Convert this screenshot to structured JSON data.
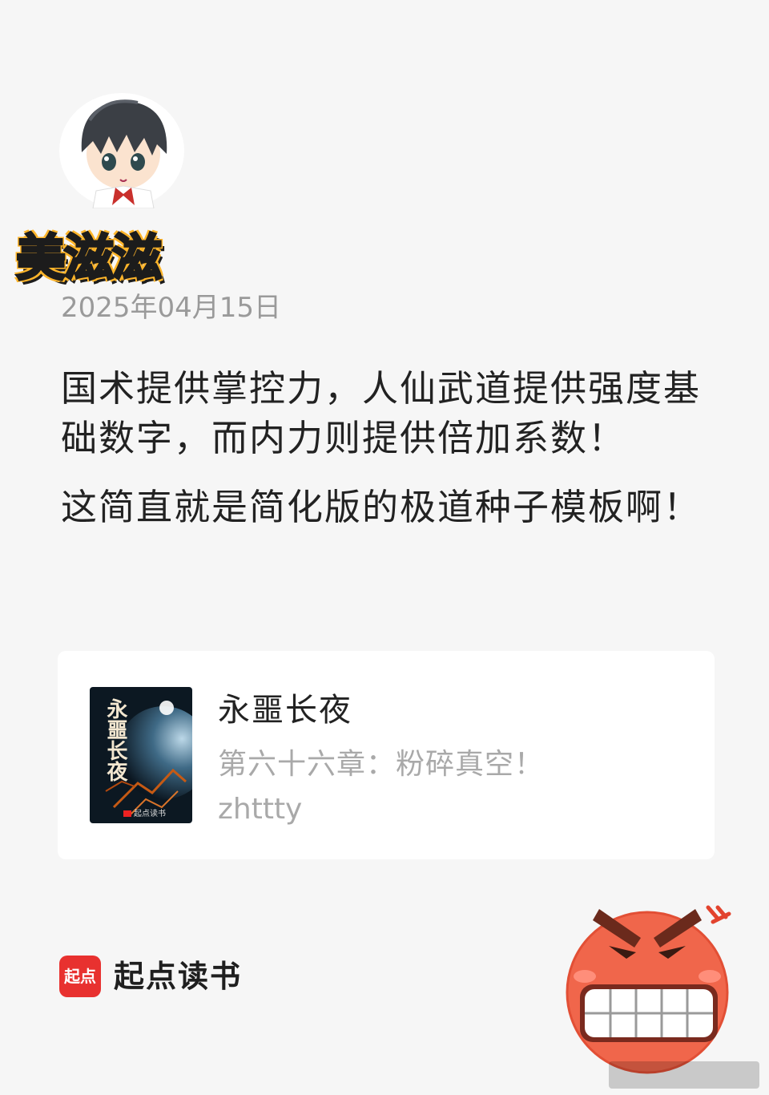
{
  "user": {
    "nickname": "美滋滋",
    "post_date": "2025年04月15日"
  },
  "post": {
    "paragraphs": [
      "国术提供掌控力，人仙武道提供强度基础数字，而内力则提供倍加系数！",
      "这简直就是简化版的极道种子模板啊！"
    ]
  },
  "book_card": {
    "cover_title": "永噩长夜",
    "cover_brand": "起点读书",
    "title": "永噩长夜",
    "chapter": "第六十六章：粉碎真空！",
    "author": "zhttty"
  },
  "app": {
    "logo_text": "起点",
    "name": "起点读书",
    "brand_color": "#e8312f"
  },
  "icons": {
    "avatar": "anime-boy-avatar",
    "sticker": "angry-face-emoji"
  }
}
